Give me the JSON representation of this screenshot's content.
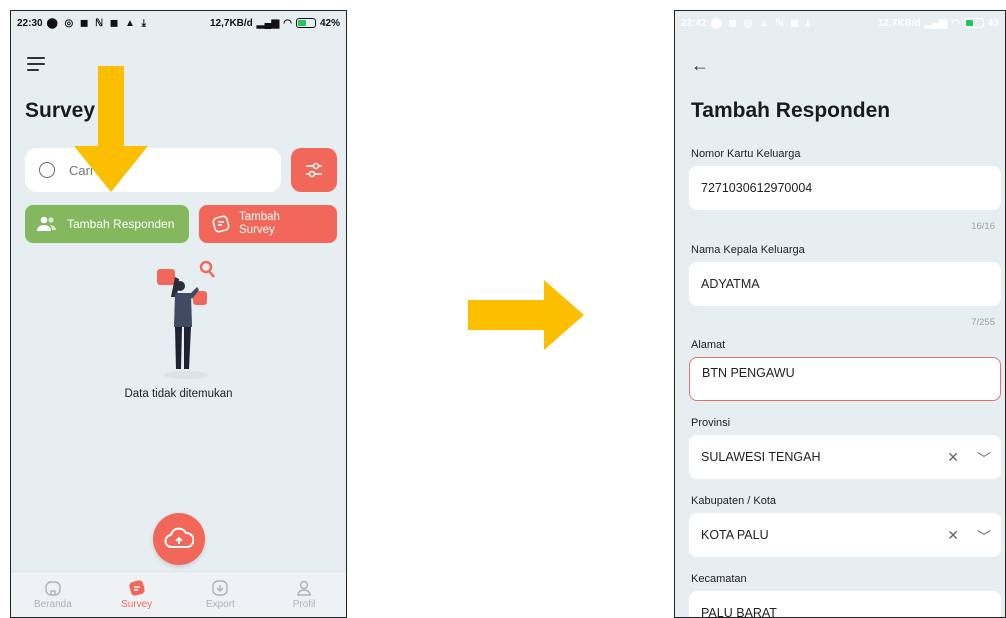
{
  "left": {
    "status": {
      "time": "22:30",
      "net": "12,7KB/d",
      "battery": "42%"
    },
    "title": "Survey",
    "search": {
      "placeholder": "Cari"
    },
    "buttons": {
      "add_respondent": "Tambah Responden",
      "add_survey": "Tambah Survey"
    },
    "empty_text": "Data tidak ditemukan",
    "nav": [
      {
        "label": "Beranda",
        "icon": "home-icon"
      },
      {
        "label": "Survey",
        "icon": "survey-icon"
      },
      {
        "label": "Export",
        "icon": "export-icon"
      },
      {
        "label": "Profil",
        "icon": "profile-icon"
      }
    ]
  },
  "right": {
    "status": {
      "time": "22:42",
      "net": "12,7KB/d",
      "battery": "43"
    },
    "title": "Tambah Responden",
    "fields": [
      {
        "label": "Nomor Kartu Keluarga",
        "value": "7271030612970004",
        "counter": "16/16"
      },
      {
        "label": "Nama Kepala Keluarga",
        "value": "ADYATMA",
        "counter": "7/255"
      },
      {
        "label": "Alamat",
        "value": "BTN PENGAWU"
      },
      {
        "label": "Provinsi",
        "value": "SULAWESI TENGAH"
      },
      {
        "label": "Kabupaten / Kota",
        "value": "KOTA PALU"
      },
      {
        "label": "Kecamatan",
        "value": "PALU BARAT"
      }
    ]
  },
  "colors": {
    "accent_red": "#f1685a",
    "green": "#84b85e",
    "arrow_yellow": "#fbbf00",
    "bg": "#e7eef2"
  }
}
